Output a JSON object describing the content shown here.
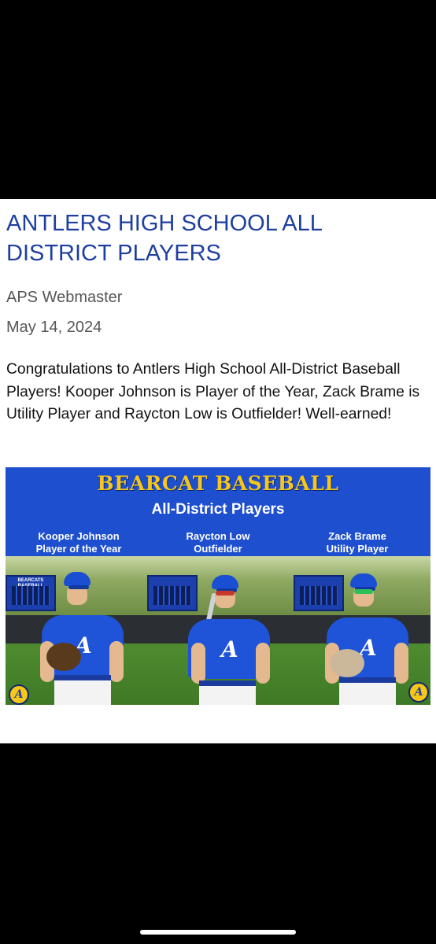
{
  "post": {
    "title": "ANTLERS HIGH SCHOOL ALL DISTRICT PLAYERS",
    "author": "APS Webmaster",
    "date": "May 14, 2024",
    "body": "Congratulations to Antlers High School All-District Baseball Players! Kooper Johnson is Player of the Year, Zack Brame is Utility Player and Raycton Low is Outfielder! Well-earned!"
  },
  "graphic": {
    "title": "BEARCAT BASEBALL",
    "subtitle": "All-District Players",
    "players": [
      {
        "name": "Kooper Johnson",
        "award": "Player of the Year"
      },
      {
        "name": "Raycton Low",
        "award": "Outfielder"
      },
      {
        "name": "Zack Brame",
        "award": "Utility Player"
      }
    ],
    "scoreboard_text": "BEARCATS BASEBALL",
    "logo_letter": "A"
  },
  "colors": {
    "title_blue": "#1f3f9e",
    "graphic_bg": "#1e4fcf",
    "graphic_title": "#f6c61b",
    "background": "#000000"
  }
}
